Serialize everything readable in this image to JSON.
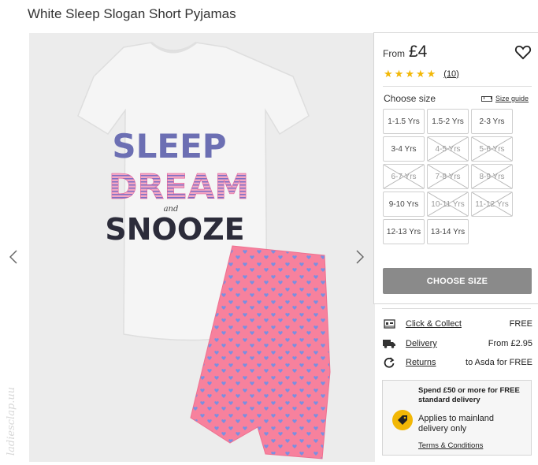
{
  "product": {
    "title": "White Sleep Slogan Short Pyjamas"
  },
  "gallery": {
    "image_alt": "White t-shirt with SLEEP DREAM and SNOOZE slogan and pink heart print shorts",
    "slogan_line1": "SLEEP",
    "slogan_line2": "DREAM",
    "slogan_small": "and",
    "slogan_line3": "SNOOZE",
    "watermark": "ladiesclap.uu"
  },
  "pricing": {
    "from_label": "From",
    "price": "£4"
  },
  "rating": {
    "stars": 5,
    "max": 5,
    "count": "(10)"
  },
  "sizes": {
    "label": "Choose size",
    "guide_label": "Size guide",
    "options": [
      {
        "label": "1-1.5 Yrs",
        "available": true
      },
      {
        "label": "1.5-2 Yrs",
        "available": true
      },
      {
        "label": "2-3 Yrs",
        "available": true
      },
      {
        "label": "3-4 Yrs",
        "available": true
      },
      {
        "label": "4-5 Yrs",
        "available": false
      },
      {
        "label": "5-6 Yrs",
        "available": false
      },
      {
        "label": "6-7 Yrs",
        "available": false
      },
      {
        "label": "7-8 Yrs",
        "available": false
      },
      {
        "label": "8-9 Yrs",
        "available": false
      },
      {
        "label": "9-10 Yrs",
        "available": true
      },
      {
        "label": "10-11 Yrs",
        "available": false
      },
      {
        "label": "11-12 Yrs",
        "available": false
      },
      {
        "label": "12-13 Yrs",
        "available": true
      },
      {
        "label": "13-14 Yrs",
        "available": true
      }
    ]
  },
  "cta": {
    "choose_size": "CHOOSE SIZE"
  },
  "delivery": {
    "click_collect": {
      "label": "Click & Collect",
      "value": "FREE",
      "icon": "store-icon"
    },
    "delivery": {
      "label": "Delivery",
      "value": "From £2.95",
      "icon": "truck-icon"
    },
    "returns": {
      "label": "Returns",
      "value": "to Asda for FREE",
      "icon": "returns-icon"
    }
  },
  "promo": {
    "headline": "Spend £50 or more for FREE standard delivery",
    "body": "Applies to mainland delivery only",
    "link": "Terms & Conditions",
    "icon": "tag-icon"
  },
  "colors": {
    "star": "#f2b705",
    "button_disabled": "#8a8a8a",
    "shorts_pink": "#f7819d",
    "heart_blue": "#7a8fe0"
  }
}
